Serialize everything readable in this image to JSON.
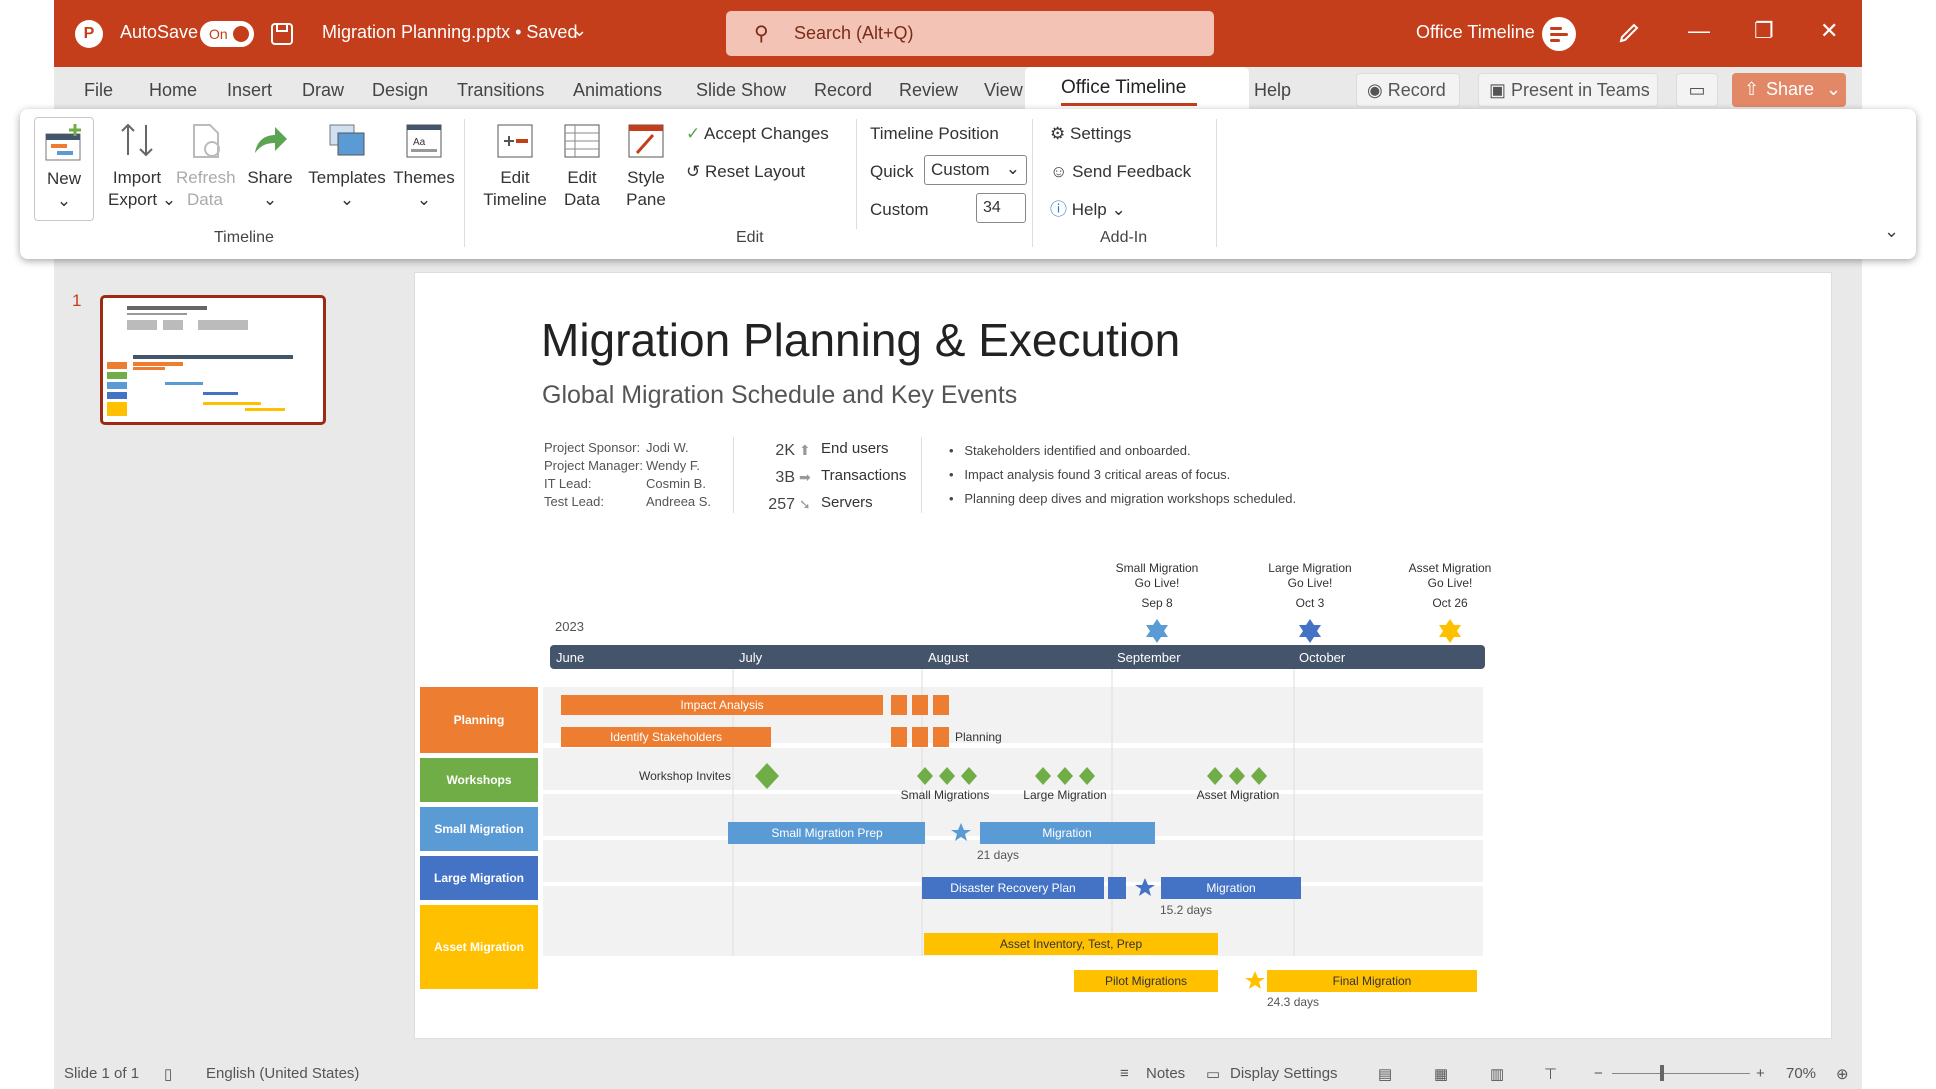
{
  "titlebar": {
    "autosave_label": "AutoSave",
    "toggle_state": "On",
    "doc_title": "Migration Planning.pptx • Saved",
    "search_placeholder": "Search (Alt+Q)",
    "account_name": "Office Timeline",
    "brand_color": "#c43e1c"
  },
  "tabs": [
    "File",
    "Home",
    "Insert",
    "Draw",
    "Design",
    "Transitions",
    "Animations",
    "Slide Show",
    "Record",
    "Review",
    "View",
    "Office Timeline",
    "Help"
  ],
  "active_tab": "Office Timeline",
  "tab_buttons": {
    "record": "Record",
    "present_teams": "Present in Teams",
    "share": "Share"
  },
  "ribbon": {
    "timeline_group": {
      "label": "Timeline",
      "new": "New",
      "import": "Import",
      "export": "Export",
      "refresh": "Refresh",
      "data": "Data",
      "share": "Share",
      "templates": "Templates",
      "themes": "Themes"
    },
    "edit_group": {
      "label": "Edit",
      "edit_timeline_1": "Edit",
      "edit_timeline_2": "Timeline",
      "edit_data_1": "Edit",
      "edit_data_2": "Data",
      "style_pane_1": "Style",
      "style_pane_2": "Pane",
      "accept_changes": "Accept Changes",
      "reset_layout": "Reset Layout",
      "timeline_position": "Timeline Position",
      "quick_label": "Quick",
      "quick_value": "Custom",
      "custom_label": "Custom",
      "custom_value": "34"
    },
    "addin_group": {
      "label": "Add-In",
      "settings": "Settings",
      "send_feedback": "Send Feedback",
      "help": "Help"
    }
  },
  "thumbnail": {
    "slide_number": "1"
  },
  "slide": {
    "title": "Migration Planning & Execution",
    "subtitle": "Global Migration Schedule and Key Events",
    "people": [
      {
        "role": "Project Sponsor:",
        "name": "Jodi W."
      },
      {
        "role": "Project Manager:",
        "name": "Wendy F."
      },
      {
        "role": "IT Lead:",
        "name": "Cosmin B."
      },
      {
        "role": "Test Lead:",
        "name": "Andreea S."
      }
    ],
    "stats": [
      {
        "value": "2K",
        "label": "End users",
        "trend": "up"
      },
      {
        "value": "3B",
        "label": "Transactions",
        "trend": "right"
      },
      {
        "value": "257",
        "label": "Servers",
        "trend": "down-right"
      }
    ],
    "bullets": [
      "Stakeholders identified and onboarded.",
      "Impact analysis found 3 critical areas of focus.",
      "Planning deep dives and migration workshops scheduled."
    ],
    "year": "2023",
    "months": [
      "June",
      "July",
      "August",
      "September",
      "October"
    ],
    "milestones": [
      {
        "title1": "Small Migration",
        "title2": "Go Live!",
        "date": "Sep 8",
        "color": "#5b9bd5"
      },
      {
        "title1": "Large Migration",
        "title2": "Go Live!",
        "date": "Oct 3",
        "color": "#4472c4"
      },
      {
        "title1": "Asset Migration",
        "title2": "Go Live!",
        "date": "Oct 26",
        "color": "#ffc000"
      }
    ],
    "swimlanes": [
      {
        "name": "Planning",
        "color": "#ed7d31"
      },
      {
        "name": "Workshops",
        "color": "#70ad47"
      },
      {
        "name": "Small Migration",
        "color": "#5b9bd5"
      },
      {
        "name": "Large Migration",
        "color": "#4472c4"
      },
      {
        "name": "Asset Migration",
        "color": "#ffc000"
      }
    ],
    "tasks": {
      "impact_analysis": "Impact Analysis",
      "identify_stakeholders": "Identify Stakeholders",
      "planning": "Planning",
      "workshop_invites": "Workshop Invites",
      "small_migrations": "Small Migrations",
      "large_migration_ws": "Large Migration",
      "asset_migration_ws": "Asset Migration",
      "small_migration_prep": "Small Migration Prep",
      "migration_small": "Migration",
      "days_21": "21 days",
      "disaster_recovery_plan": "Disaster Recovery Plan",
      "migration_large": "Migration",
      "days_15": "15.2 days",
      "asset_inventory": "Asset Inventory, Test, Prep",
      "pilot_migrations": "Pilot Migrations",
      "final_migration": "Final Migration",
      "days_24": "24.3 days"
    }
  },
  "statusbar": {
    "slide_info": "Slide 1 of 1",
    "language": "English (United States)",
    "notes": "Notes",
    "display_settings": "Display Settings",
    "zoom": "70%"
  }
}
